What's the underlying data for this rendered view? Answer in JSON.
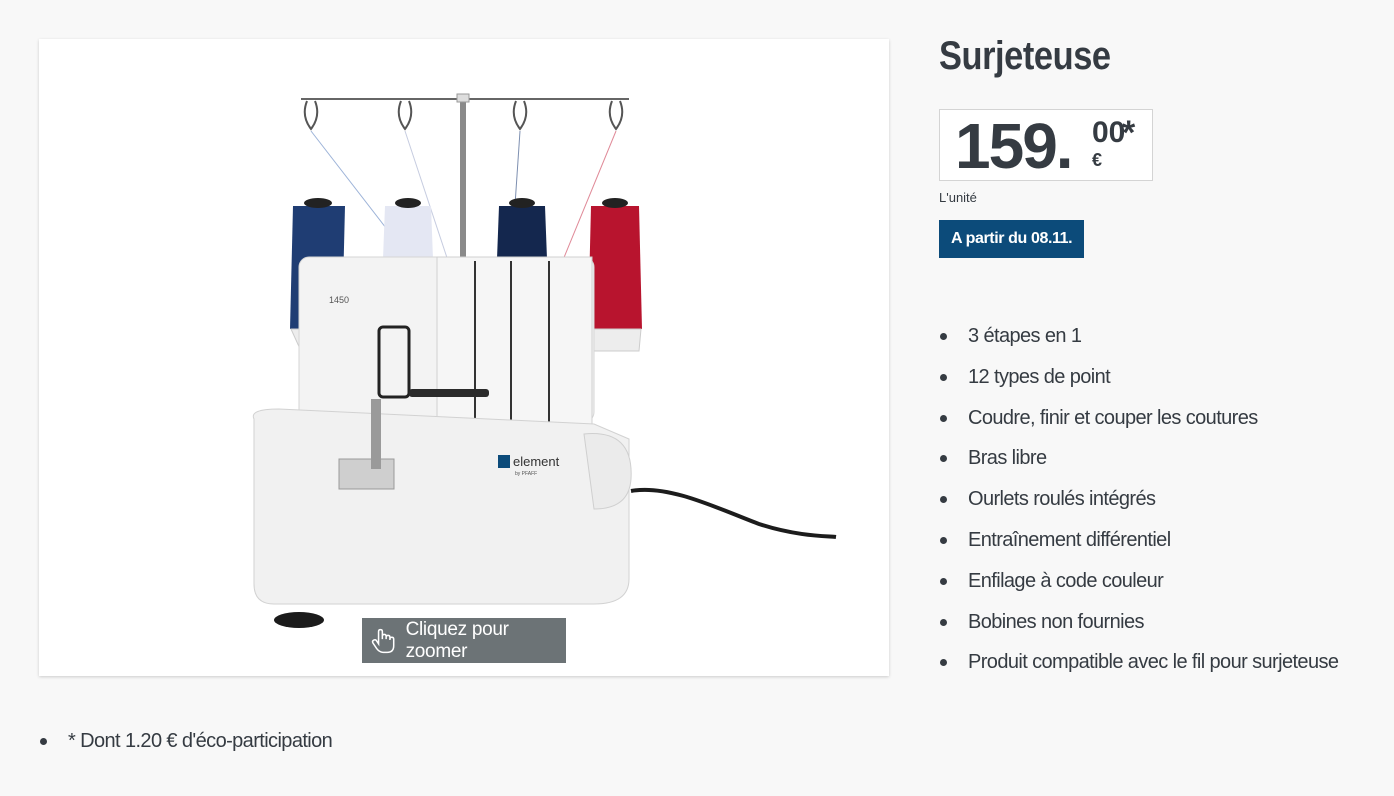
{
  "product": {
    "title": "Surjeteuse",
    "image_alt": "Surjeteuse element by Pfaff 1450",
    "image_labels": {
      "model": "1450",
      "brand": "element",
      "sub_brand": "by PFAFF"
    },
    "zoom_label": "Cliquez pour zoomer"
  },
  "price": {
    "integer": "159.",
    "decimals": "00",
    "currency": "€",
    "asterisk": "*",
    "unit": "L'unité"
  },
  "availability": "A partir du 08.11.",
  "features": [
    "3 étapes en 1",
    "12 types de point",
    "Coudre, finir et couper les coutures",
    "Bras libre",
    "Ourlets roulés intégrés",
    "Entraînement différentiel",
    "Enfilage à code couleur",
    "Bobines non fournies",
    "Produit compatible avec le fil pour surjeteuse"
  ],
  "footnote": "* Dont 1.20 € d'éco-participation",
  "colors": {
    "background": "#f8f8f8",
    "text": "#353b42",
    "availability_bg": "#0c4b7a",
    "zoom_bg": "#6c7376",
    "thread_1": "#1f3d73",
    "thread_2": "#e4e7f3",
    "thread_3": "#14274e",
    "thread_4": "#b8142e"
  }
}
